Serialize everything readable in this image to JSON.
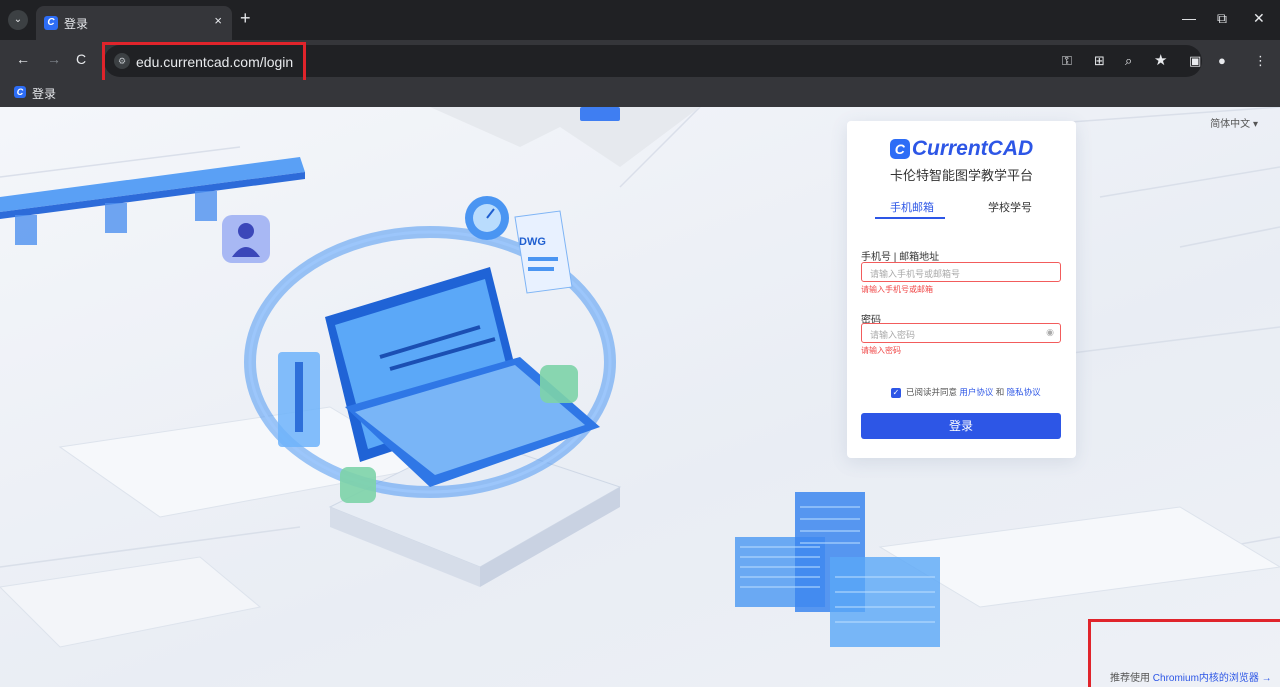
{
  "browser": {
    "tab_title": "登录",
    "tab_close": "×",
    "new_tab": "+",
    "url": "edu.currentcad.com/login",
    "bookmark": "登录",
    "window": {
      "minimize": "—",
      "restore": "⧉",
      "close": "✕"
    },
    "nav": {
      "back": "←",
      "forward": "→",
      "reload": "C"
    }
  },
  "page": {
    "language": "简体中文 ▾",
    "logo_mark": "C",
    "logo_text": "CurrentCAD",
    "subtitle": "卡伦特智能图学教学平台",
    "tabs": [
      "手机邮箱",
      "学校学号"
    ],
    "fields": {
      "account": {
        "label": "手机号 | 邮箱地址",
        "placeholder": "请输入手机号或邮箱号",
        "error": "请输入手机号或邮箱"
      },
      "password": {
        "label": "密码",
        "placeholder": "请输入密码",
        "error": "请输入密码"
      }
    },
    "agreement": {
      "prefix": "已阅读并同意",
      "terms": "用户协议",
      "and": "和",
      "privacy": "隐私协议",
      "checked": true
    },
    "login_button": "登录",
    "hint": {
      "prefix": "推荐使用",
      "link": "Chromium内核的浏览器 →"
    }
  },
  "colors": {
    "brand": "#2d56e6",
    "error": "#f04848",
    "highlight": "#e0242b"
  }
}
